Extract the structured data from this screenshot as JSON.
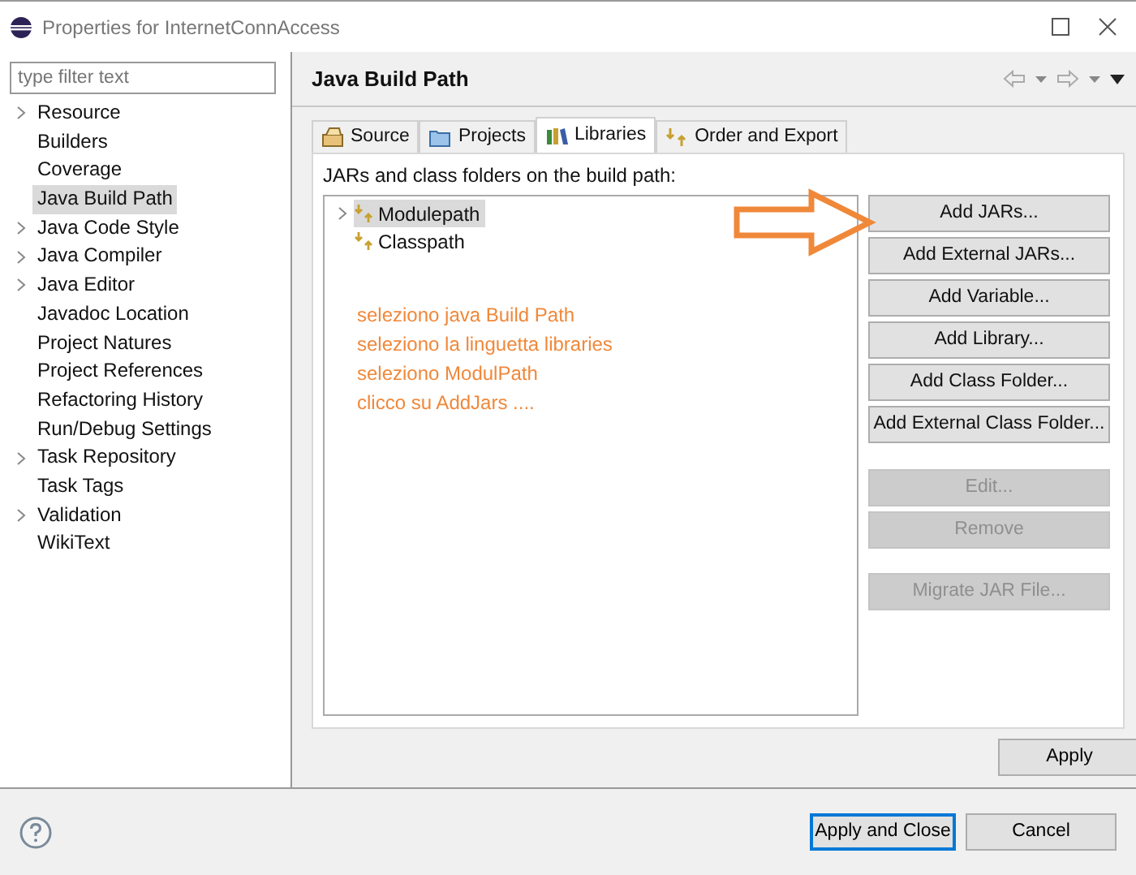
{
  "window": {
    "title": "Properties for InternetConnAccess"
  },
  "filter": {
    "placeholder": "type filter text"
  },
  "sidebar": {
    "items": [
      {
        "label": "Resource",
        "expandable": true,
        "selected": false
      },
      {
        "label": "Builders",
        "expandable": false,
        "selected": false
      },
      {
        "label": "Coverage",
        "expandable": false,
        "selected": false
      },
      {
        "label": "Java Build Path",
        "expandable": false,
        "selected": true
      },
      {
        "label": "Java Code Style",
        "expandable": true,
        "selected": false
      },
      {
        "label": "Java Compiler",
        "expandable": true,
        "selected": false
      },
      {
        "label": "Java Editor",
        "expandable": true,
        "selected": false
      },
      {
        "label": "Javadoc Location",
        "expandable": false,
        "selected": false
      },
      {
        "label": "Project Natures",
        "expandable": false,
        "selected": false
      },
      {
        "label": "Project References",
        "expandable": false,
        "selected": false
      },
      {
        "label": "Refactoring History",
        "expandable": false,
        "selected": false
      },
      {
        "label": "Run/Debug Settings",
        "expandable": false,
        "selected": false
      },
      {
        "label": "Task Repository",
        "expandable": true,
        "selected": false
      },
      {
        "label": "Task Tags",
        "expandable": false,
        "selected": false
      },
      {
        "label": "Validation",
        "expandable": true,
        "selected": false
      },
      {
        "label": "WikiText",
        "expandable": false,
        "selected": false
      }
    ]
  },
  "page": {
    "title": "Java Build Path"
  },
  "tabs": [
    {
      "label": "Source",
      "selected": false
    },
    {
      "label": "Projects",
      "selected": false
    },
    {
      "label": "Libraries",
      "selected": true
    },
    {
      "label": "Order and Export",
      "selected": false
    }
  ],
  "list_label": "JARs and class folders on the build path:",
  "tree": [
    {
      "label": "Modulepath",
      "expandable": true,
      "selected": true
    },
    {
      "label": "Classpath",
      "expandable": false,
      "selected": false
    }
  ],
  "annotation": [
    "seleziono java Build Path",
    "seleziono la linguetta libraries",
    "seleziono ModulPath",
    "clicco su AddJars ...."
  ],
  "button_groups": [
    [
      {
        "label": "Add JARs...",
        "disabled": false
      },
      {
        "label": "Add External JARs...",
        "disabled": false
      },
      {
        "label": "Add Variable...",
        "disabled": false
      },
      {
        "label": "Add Library...",
        "disabled": false
      },
      {
        "label": "Add Class Folder...",
        "disabled": false
      },
      {
        "label": "Add External Class Folder...",
        "disabled": false
      }
    ],
    [
      {
        "label": "Edit...",
        "disabled": true
      },
      {
        "label": "Remove",
        "disabled": true
      }
    ],
    [
      {
        "label": "Migrate JAR File...",
        "disabled": true
      }
    ]
  ],
  "apply": "Apply",
  "footer_buttons": [
    {
      "label": "Apply and Close",
      "default": true
    },
    {
      "label": "Cancel",
      "default": false
    }
  ]
}
